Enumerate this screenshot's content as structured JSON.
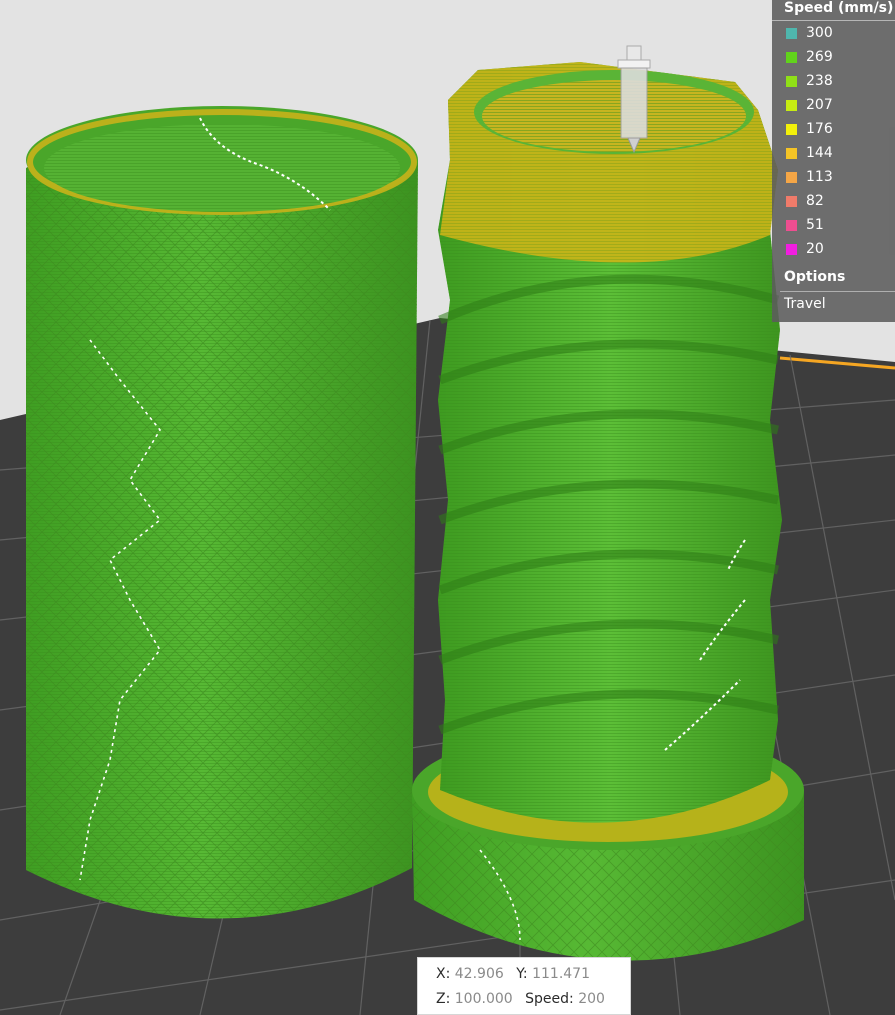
{
  "legend": {
    "title": "Speed (mm/s)",
    "items": [
      {
        "label": "300",
        "color": "#4fb6ad"
      },
      {
        "label": "269",
        "color": "#61d31b"
      },
      {
        "label": "238",
        "color": "#90e017"
      },
      {
        "label": "207",
        "color": "#c7ec12"
      },
      {
        "label": "176",
        "color": "#f3f00a"
      },
      {
        "label": "144",
        "color": "#f5c426"
      },
      {
        "label": "113",
        "color": "#f5a646"
      },
      {
        "label": "82",
        "color": "#f07b6a"
      },
      {
        "label": "51",
        "color": "#ee4e90"
      },
      {
        "label": "20",
        "color": "#f11ee0"
      }
    ],
    "options_label": "Options",
    "travel_label": "Travel"
  },
  "info": {
    "x_label": "X:",
    "x_value": "42.906",
    "y_label": "Y:",
    "y_value": "111.471",
    "z_label": "Z:",
    "z_value": "100.000",
    "speed_label": "Speed:",
    "speed_value": "200"
  },
  "colors": {
    "background": "#e3e3e3",
    "bed": "#3d3d3d",
    "bed_edge": "#f5a623",
    "print_green": "#4cae2c",
    "print_yellow": "#c9b418"
  },
  "icons": {
    "nozzle": "nozzle-icon"
  }
}
